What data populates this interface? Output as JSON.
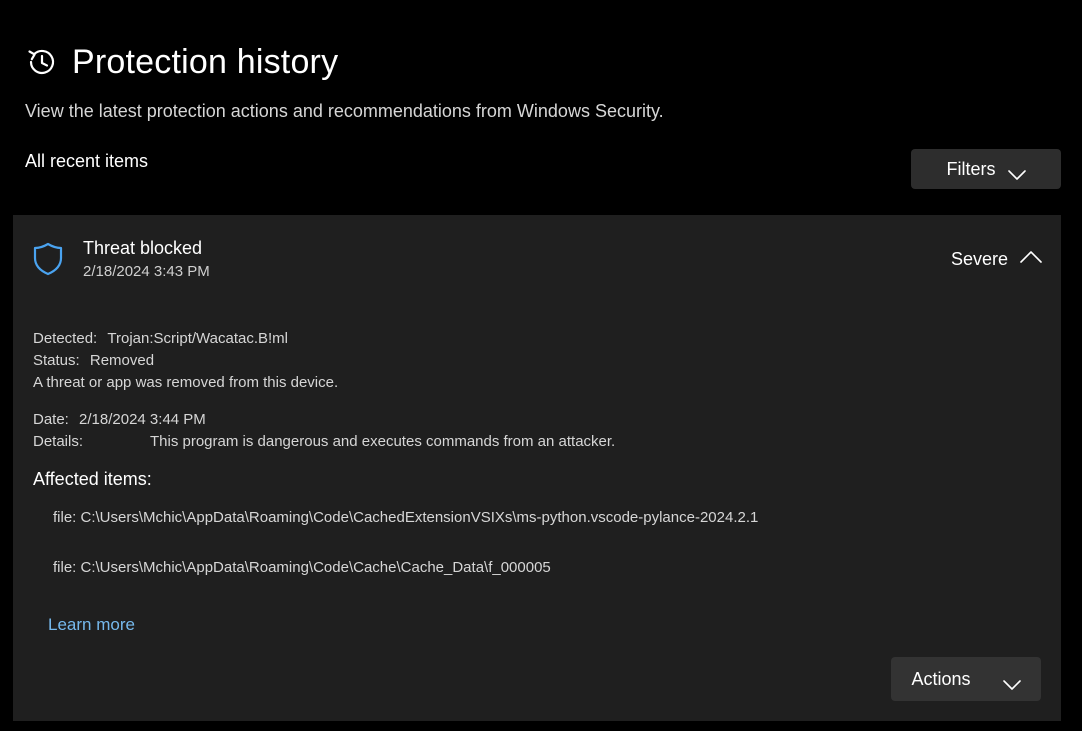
{
  "header": {
    "title": "Protection history",
    "icon": "history-clock-icon",
    "subtitle": "View the latest protection actions and recommendations from Windows Security."
  },
  "list": {
    "section_label": "All recent items",
    "filters_label": "Filters"
  },
  "threat": {
    "icon": "shield-icon",
    "title": "Threat blocked",
    "timestamp": "2/18/2024 3:43 PM",
    "severity": "Severe",
    "detected_label": "Detected:",
    "detected_value": "Trojan:Script/Wacatac.B!ml",
    "status_label": "Status:",
    "status_value": "Removed",
    "status_message": "A threat or app was removed from this device.",
    "date_label": "Date:",
    "date_value": "2/18/2024 3:44 PM",
    "details_label": "Details:",
    "details_value": "This program is dangerous and executes commands from an attacker.",
    "affected_heading": "Affected items:",
    "affected_items": [
      "file: C:\\Users\\Mchic\\AppData\\Roaming\\Code\\CachedExtensionVSIXs\\ms-python.vscode-pylance-2024.2.1",
      "file: C:\\Users\\Mchic\\AppData\\Roaming\\Code\\Cache\\Cache_Data\\f_000005"
    ],
    "learn_more": "Learn more",
    "actions_label": "Actions"
  },
  "colors": {
    "background": "#000000",
    "card": "#1f1f1f",
    "button": "#2d2d2d",
    "link": "#76b9ed",
    "shield": "#4aa3f0"
  }
}
